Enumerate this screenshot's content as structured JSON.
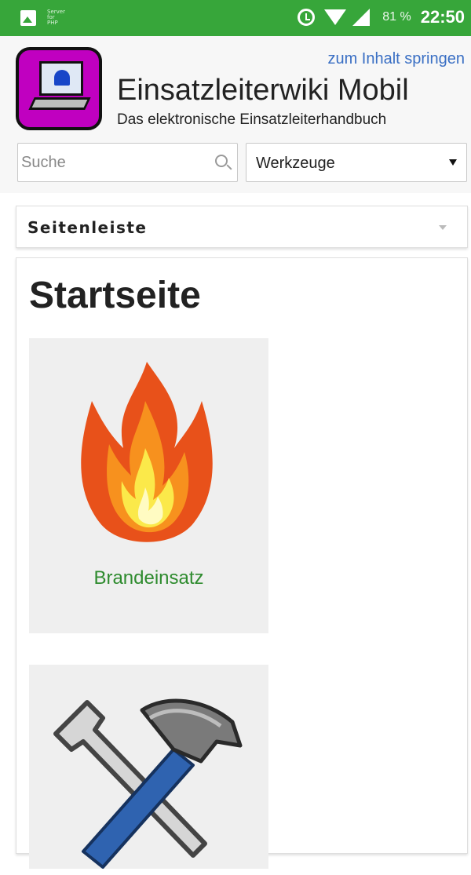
{
  "status_bar": {
    "php_label": "Server for PHP",
    "battery": "81 %",
    "time": "22:50",
    "icons": [
      "gallery-icon",
      "alarm-icon",
      "wifi-icon",
      "signal-icon"
    ]
  },
  "header": {
    "skip_link": "zum Inhalt springen",
    "site_title": "Einsatzleiterwiki Mobil",
    "site_subtitle": "Das elektronische Einsatzleiterhandbuch",
    "search_placeholder": "Suche",
    "tools_label": "Werkzeuge"
  },
  "sidebar": {
    "label": "Seitenleiste"
  },
  "main": {
    "page_title": "Startseite",
    "tiles": [
      {
        "caption": "Brandeinsatz",
        "icon": "fire-icon"
      },
      {
        "caption": "",
        "icon": "tools-icon"
      }
    ]
  },
  "colors": {
    "status_bar": "#37a63a",
    "link": "#3a6fc4",
    "caption": "#2e8b2e",
    "logo_bg": "#c000c0"
  }
}
